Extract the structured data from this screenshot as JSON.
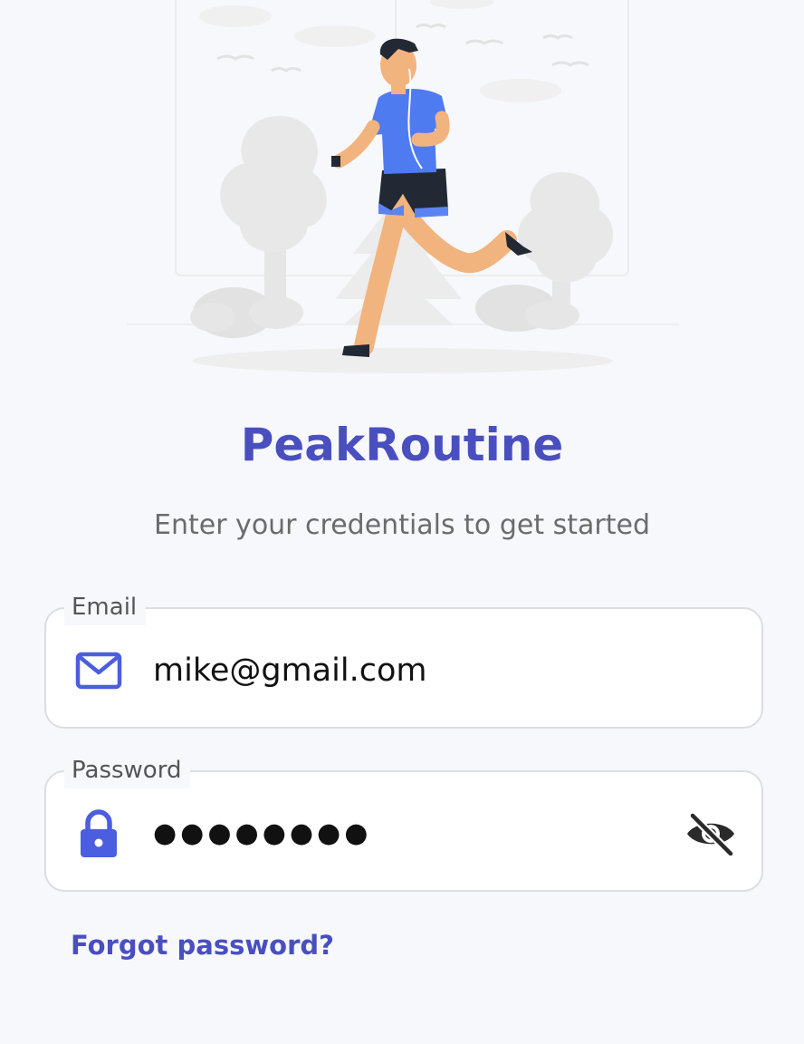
{
  "app": {
    "title": "PeakRoutine",
    "subtitle": "Enter your credentials to get started"
  },
  "hero": {
    "illustration": "runner-illustration"
  },
  "email_field": {
    "label": "Email",
    "value": "mike@gmail.com",
    "icon": "mail-icon"
  },
  "password_field": {
    "label": "Password",
    "value": "●●●●●●●●",
    "icon": "lock-icon",
    "toggle_icon": "eye-off-icon"
  },
  "forgot_password": {
    "label": "Forgot password?"
  },
  "colors": {
    "accent": "#4a4fbf",
    "icon": "#4b5ee0",
    "background": "#f7f8fc",
    "field_border": "#dcdde2",
    "shirt": "#4f7bf0"
  }
}
